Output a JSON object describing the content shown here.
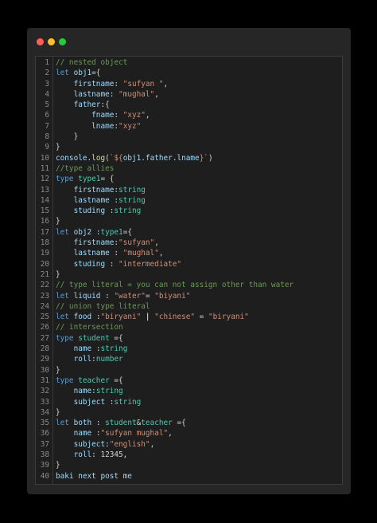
{
  "window": {
    "dots": [
      {
        "name": "close",
        "color": "#ff5f56"
      },
      {
        "name": "minimize",
        "color": "#ffbd2e"
      },
      {
        "name": "maximize",
        "color": "#27c93f"
      }
    ]
  },
  "editor": {
    "lines": [
      {
        "n": "1",
        "tokens": [
          [
            "c",
            "// nested object"
          ]
        ]
      },
      {
        "n": "2",
        "tokens": [
          [
            "k",
            "let "
          ],
          [
            "v",
            "obj1"
          ],
          [
            "p",
            "={"
          ]
        ]
      },
      {
        "n": "3",
        "tokens": [
          [
            "p",
            "    "
          ],
          [
            "v",
            "firstname"
          ],
          [
            "p",
            ": "
          ],
          [
            "s",
            "\"sufyan \""
          ],
          [
            "p",
            ","
          ]
        ]
      },
      {
        "n": "4",
        "tokens": [
          [
            "p",
            "    "
          ],
          [
            "v",
            "lastname"
          ],
          [
            "p",
            ": "
          ],
          [
            "s",
            "\"mughal\""
          ],
          [
            "p",
            ","
          ]
        ]
      },
      {
        "n": "5",
        "tokens": [
          [
            "p",
            "    "
          ],
          [
            "v",
            "father"
          ],
          [
            "p",
            ":{"
          ]
        ]
      },
      {
        "n": "6",
        "tokens": [
          [
            "p",
            "        "
          ],
          [
            "v",
            "fname"
          ],
          [
            "p",
            ": "
          ],
          [
            "s",
            "\"xyz\""
          ],
          [
            "p",
            ","
          ]
        ]
      },
      {
        "n": "7",
        "tokens": [
          [
            "p",
            "        "
          ],
          [
            "v",
            "lname"
          ],
          [
            "p",
            ":"
          ],
          [
            "s",
            "\"xyz\""
          ]
        ]
      },
      {
        "n": "8",
        "tokens": [
          [
            "p",
            "    }"
          ]
        ]
      },
      {
        "n": "9",
        "tokens": [
          [
            "p",
            "}"
          ]
        ]
      },
      {
        "n": "10",
        "tokens": [
          [
            "v",
            "console"
          ],
          [
            "p",
            "."
          ],
          [
            "f",
            "log"
          ],
          [
            "p",
            "("
          ],
          [
            "s",
            "`${"
          ],
          [
            "v",
            "obj1"
          ],
          [
            "p",
            "."
          ],
          [
            "v",
            "father"
          ],
          [
            "p",
            "."
          ],
          [
            "v",
            "lname"
          ],
          [
            "s",
            "}`"
          ],
          [
            "p",
            ")"
          ]
        ]
      },
      {
        "n": "11",
        "tokens": [
          [
            "c",
            "//type allies"
          ]
        ]
      },
      {
        "n": "12",
        "tokens": [
          [
            "k",
            "type "
          ],
          [
            "t",
            "type1"
          ],
          [
            "p",
            "= {"
          ]
        ]
      },
      {
        "n": "13",
        "tokens": [
          [
            "p",
            "    "
          ],
          [
            "v",
            "firstname"
          ],
          [
            "p",
            ":"
          ],
          [
            "t",
            "string"
          ]
        ]
      },
      {
        "n": "14",
        "tokens": [
          [
            "p",
            "    "
          ],
          [
            "v",
            "lastname "
          ],
          [
            "p",
            ":"
          ],
          [
            "t",
            "string"
          ]
        ]
      },
      {
        "n": "15",
        "tokens": [
          [
            "p",
            "    "
          ],
          [
            "v",
            "studing "
          ],
          [
            "p",
            ":"
          ],
          [
            "t",
            "string"
          ]
        ]
      },
      {
        "n": "16",
        "tokens": [
          [
            "p",
            "}"
          ]
        ]
      },
      {
        "n": "17",
        "tokens": [
          [
            "k",
            "let "
          ],
          [
            "v",
            "obj2 "
          ],
          [
            "p",
            ":"
          ],
          [
            "t",
            "type1"
          ],
          [
            "p",
            "={"
          ]
        ]
      },
      {
        "n": "18",
        "tokens": [
          [
            "p",
            "    "
          ],
          [
            "v",
            "firstname"
          ],
          [
            "p",
            ":"
          ],
          [
            "s",
            "\"sufyan\""
          ],
          [
            "p",
            ","
          ]
        ]
      },
      {
        "n": "19",
        "tokens": [
          [
            "p",
            "    "
          ],
          [
            "v",
            "lastname "
          ],
          [
            "p",
            ": "
          ],
          [
            "s",
            "\"mughal\""
          ],
          [
            "p",
            ","
          ]
        ]
      },
      {
        "n": "20",
        "tokens": [
          [
            "p",
            "    "
          ],
          [
            "v",
            "studing "
          ],
          [
            "p",
            ": "
          ],
          [
            "s",
            "\"intermediate\""
          ]
        ]
      },
      {
        "n": "21",
        "tokens": [
          [
            "p",
            "}"
          ]
        ]
      },
      {
        "n": "22",
        "tokens": [
          [
            "c",
            "// type literal = you can not assign other than water"
          ]
        ]
      },
      {
        "n": "23",
        "tokens": [
          [
            "k",
            "let "
          ],
          [
            "v",
            "liquid "
          ],
          [
            "p",
            ": "
          ],
          [
            "s",
            "\"water\""
          ],
          [
            "p",
            "= "
          ],
          [
            "s",
            "\"biyani\""
          ]
        ]
      },
      {
        "n": "24",
        "tokens": [
          [
            "c",
            "// union type literal"
          ]
        ]
      },
      {
        "n": "25",
        "tokens": [
          [
            "k",
            "let "
          ],
          [
            "v",
            "food "
          ],
          [
            "p",
            ":"
          ],
          [
            "s",
            "\"biryani\""
          ],
          [
            "w",
            " | "
          ],
          [
            "s",
            "\"chinese\""
          ],
          [
            "p",
            " = "
          ],
          [
            "s",
            "\"biryani\""
          ]
        ]
      },
      {
        "n": "26",
        "tokens": [
          [
            "c",
            "// intersection"
          ]
        ]
      },
      {
        "n": "27",
        "tokens": [
          [
            "k",
            "type "
          ],
          [
            "t",
            "student "
          ],
          [
            "p",
            "={"
          ]
        ]
      },
      {
        "n": "28",
        "tokens": [
          [
            "p",
            "    "
          ],
          [
            "v",
            "name "
          ],
          [
            "p",
            ":"
          ],
          [
            "t",
            "string"
          ]
        ]
      },
      {
        "n": "29",
        "tokens": [
          [
            "p",
            "    "
          ],
          [
            "v",
            "roll"
          ],
          [
            "p",
            ":"
          ],
          [
            "t",
            "number"
          ]
        ]
      },
      {
        "n": "30",
        "tokens": [
          [
            "p",
            "}"
          ]
        ]
      },
      {
        "n": "31",
        "tokens": [
          [
            "k",
            "type "
          ],
          [
            "t",
            "teacher "
          ],
          [
            "p",
            "={"
          ]
        ]
      },
      {
        "n": "32",
        "tokens": [
          [
            "p",
            "    "
          ],
          [
            "v",
            "name"
          ],
          [
            "p",
            ":"
          ],
          [
            "t",
            "string"
          ]
        ]
      },
      {
        "n": "33",
        "tokens": [
          [
            "p",
            "    "
          ],
          [
            "v",
            "subject "
          ],
          [
            "p",
            ":"
          ],
          [
            "t",
            "string"
          ]
        ]
      },
      {
        "n": "34",
        "tokens": [
          [
            "p",
            "}"
          ]
        ]
      },
      {
        "n": "35",
        "tokens": [
          [
            "k",
            "let "
          ],
          [
            "v",
            "both "
          ],
          [
            "p",
            ": "
          ],
          [
            "t",
            "student"
          ],
          [
            "p",
            "&"
          ],
          [
            "t",
            "teacher "
          ],
          [
            "p",
            "={"
          ]
        ]
      },
      {
        "n": "36",
        "tokens": [
          [
            "p",
            "    "
          ],
          [
            "v",
            "name "
          ],
          [
            "p",
            ":"
          ],
          [
            "s",
            "\"sufyan mughal\""
          ],
          [
            "p",
            ","
          ]
        ]
      },
      {
        "n": "37",
        "tokens": [
          [
            "p",
            "    "
          ],
          [
            "v",
            "subject"
          ],
          [
            "p",
            ":"
          ],
          [
            "s",
            "\"english\""
          ],
          [
            "p",
            ","
          ]
        ]
      },
      {
        "n": "38",
        "tokens": [
          [
            "p",
            "    "
          ],
          [
            "v",
            "roll"
          ],
          [
            "p",
            ": 12345,"
          ]
        ]
      },
      {
        "n": "39",
        "tokens": [
          [
            "p",
            "}"
          ]
        ]
      },
      {
        "n": "40",
        "tokens": [
          [
            "v",
            "baki next post me"
          ]
        ]
      }
    ]
  }
}
